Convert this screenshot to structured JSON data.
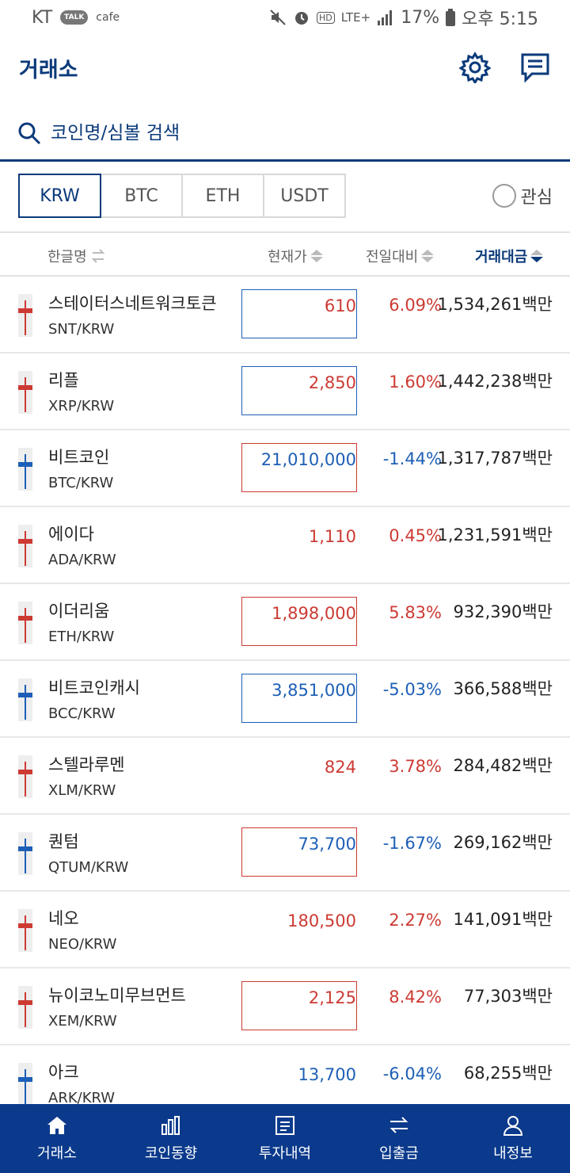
{
  "status": {
    "carrier": "KT",
    "talk_label": "TALK",
    "cafe_label": "cafe",
    "hd_label": "HD",
    "network": "LTE+",
    "battery": "17%",
    "time": "오후 5:15"
  },
  "header": {
    "title": "거래소",
    "settings_icon": "gear-icon",
    "messages_icon": "chat-icon"
  },
  "search": {
    "placeholder": "코인명/심볼 검색"
  },
  "tabs": [
    "KRW",
    "BTC",
    "ETH",
    "USDT"
  ],
  "favorite_label": "관심",
  "columns": {
    "name": "한글명",
    "price": "현재가",
    "change": "전일대비",
    "volume": "거래대금"
  },
  "colors": {
    "up": "#cc3a33",
    "down": "#1d5fb6",
    "brand": "#0b3a7a"
  },
  "rows": [
    {
      "name": "스테이터스네트워크토큰",
      "symbol": "SNT/KRW",
      "price": "610",
      "change": "6.09%",
      "volume": "1,534,261백만",
      "dir": "up",
      "box": "blue"
    },
    {
      "name": "리플",
      "symbol": "XRP/KRW",
      "price": "2,850",
      "change": "1.60%",
      "volume": "1,442,238백만",
      "dir": "up",
      "box": "blue"
    },
    {
      "name": "비트코인",
      "symbol": "BTC/KRW",
      "price": "21,010,000",
      "change": "-1.44%",
      "volume": "1,317,787백만",
      "dir": "down",
      "box": "red"
    },
    {
      "name": "에이다",
      "symbol": "ADA/KRW",
      "price": "1,110",
      "change": "0.45%",
      "volume": "1,231,591백만",
      "dir": "up",
      "box": ""
    },
    {
      "name": "이더리움",
      "symbol": "ETH/KRW",
      "price": "1,898,000",
      "change": "5.83%",
      "volume": "932,390백만",
      "dir": "up",
      "box": "red"
    },
    {
      "name": "비트코인캐시",
      "symbol": "BCC/KRW",
      "price": "3,851,000",
      "change": "-5.03%",
      "volume": "366,588백만",
      "dir": "down",
      "box": "blue"
    },
    {
      "name": "스텔라루멘",
      "symbol": "XLM/KRW",
      "price": "824",
      "change": "3.78%",
      "volume": "284,482백만",
      "dir": "up",
      "box": ""
    },
    {
      "name": "퀀텀",
      "symbol": "QTUM/KRW",
      "price": "73,700",
      "change": "-1.67%",
      "volume": "269,162백만",
      "dir": "down",
      "box": "red"
    },
    {
      "name": "네오",
      "symbol": "NEO/KRW",
      "price": "180,500",
      "change": "2.27%",
      "volume": "141,091백만",
      "dir": "up",
      "box": ""
    },
    {
      "name": "뉴이코노미무브먼트",
      "symbol": "XEM/KRW",
      "price": "2,125",
      "change": "8.42%",
      "volume": "77,303백만",
      "dir": "up",
      "box": "red"
    },
    {
      "name": "아크",
      "symbol": "ARK/KRW",
      "price": "13,700",
      "change": "-6.04%",
      "volume": "68,255백만",
      "dir": "down",
      "box": ""
    }
  ],
  "nav": [
    {
      "label": "거래소",
      "icon": "home-icon"
    },
    {
      "label": "코인동향",
      "icon": "bar-chart-icon"
    },
    {
      "label": "투자내역",
      "icon": "document-icon"
    },
    {
      "label": "입출금",
      "icon": "transfer-icon"
    },
    {
      "label": "내정보",
      "icon": "user-icon"
    }
  ]
}
